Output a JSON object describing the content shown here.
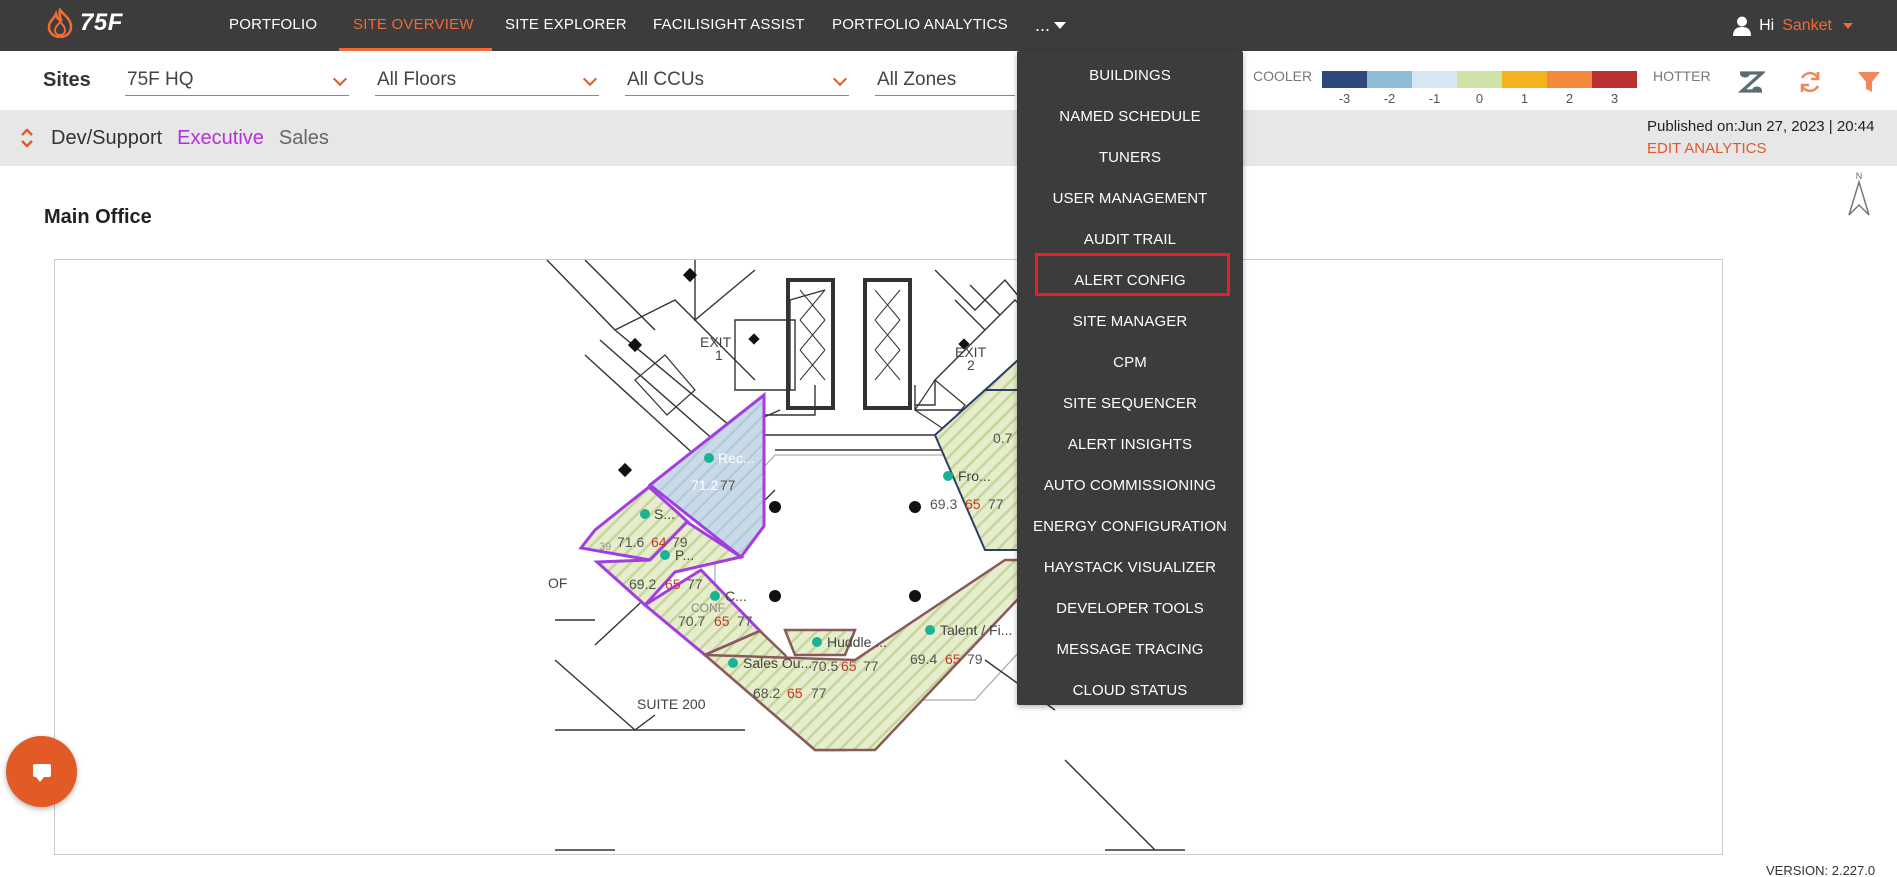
{
  "brand": {
    "logo_text": "75F"
  },
  "nav": {
    "items": [
      {
        "label": "PORTFOLIO"
      },
      {
        "label": "SITE OVERVIEW"
      },
      {
        "label": "SITE EXPLORER"
      },
      {
        "label": "FACILISIGHT ASSIST"
      },
      {
        "label": "PORTFOLIO ANALYTICS"
      }
    ],
    "more_label": "...",
    "active_index": 1,
    "greeting": "Hi",
    "user_name": "Sanket"
  },
  "filters": {
    "sites_label": "Sites",
    "site": "75F HQ",
    "floors": "All Floors",
    "ccus": "All CCUs",
    "zones": "All Zones"
  },
  "temp_legend": {
    "cooler_label": "COOLER",
    "hotter_label": "HOTTER",
    "scale": [
      {
        "value": "-3",
        "color": "#2e4a7a"
      },
      {
        "value": "-2",
        "color": "#8fbcd6"
      },
      {
        "value": "-1",
        "color": "#d6e6f3"
      },
      {
        "value": "0",
        "color": "#cfe3a6"
      },
      {
        "value": "1",
        "color": "#f5b21f"
      },
      {
        "value": "2",
        "color": "#f28a3c"
      },
      {
        "value": "3",
        "color": "#b83232"
      }
    ]
  },
  "toolbar_icons": [
    "zendesk-icon",
    "refresh-icon",
    "filter-icon"
  ],
  "subbar": {
    "tabs": [
      "Dev/Support",
      "Executive",
      "Sales"
    ],
    "published": "Published on:Jun 27, 2023 | 20:44",
    "edit_analytics": "EDIT ANALYTICS"
  },
  "main": {
    "title": "Main Office",
    "north_label": "N"
  },
  "floor_plan": {
    "labels": {
      "exit1": "EXIT",
      "exit1_num": "1",
      "exit2": "EXIT",
      "exit2_num": "2",
      "of": "OF",
      "suite": "SUITE 200",
      "conf": "CONF",
      "number_39": "39",
      "number_07": "0.7"
    },
    "zones": [
      {
        "name": "Rec...",
        "temp": "71.2",
        "heat": "",
        "cool": "77"
      },
      {
        "name": "S...",
        "temp": "71.6",
        "heat": "64",
        "cool": "79"
      },
      {
        "name": "P...",
        "temp": "69.2",
        "heat": "65",
        "cool": "77"
      },
      {
        "name": "C...",
        "temp": "70.7",
        "heat": "65",
        "cool": "77"
      },
      {
        "name": "Sales Ou...",
        "temp": "68.2",
        "heat": "65",
        "cool": "77"
      },
      {
        "name": "Huddle ...",
        "temp": "70.5",
        "heat": "65",
        "cool": "77"
      },
      {
        "name": "Talent / Fi...",
        "temp": "69.4",
        "heat": "65",
        "cool": "79"
      },
      {
        "name": "Fro...",
        "temp": "69.3",
        "heat": "65",
        "cool": "77"
      }
    ]
  },
  "menu": {
    "items": [
      "BUILDINGS",
      "NAMED SCHEDULE",
      "TUNERS",
      "USER MANAGEMENT",
      "AUDIT TRAIL",
      "ALERT CONFIG",
      "SITE MANAGER",
      "CPM",
      "SITE SEQUENCER",
      "ALERT INSIGHTS",
      "AUTO COMMISSIONING",
      "ENERGY CONFIGURATION",
      "HAYSTACK VISUALIZER",
      "DEVELOPER TOOLS",
      "MESSAGE TRACING",
      "CLOUD STATUS"
    ],
    "highlighted_index": 5
  },
  "version": "VERSION: 2.227.0"
}
